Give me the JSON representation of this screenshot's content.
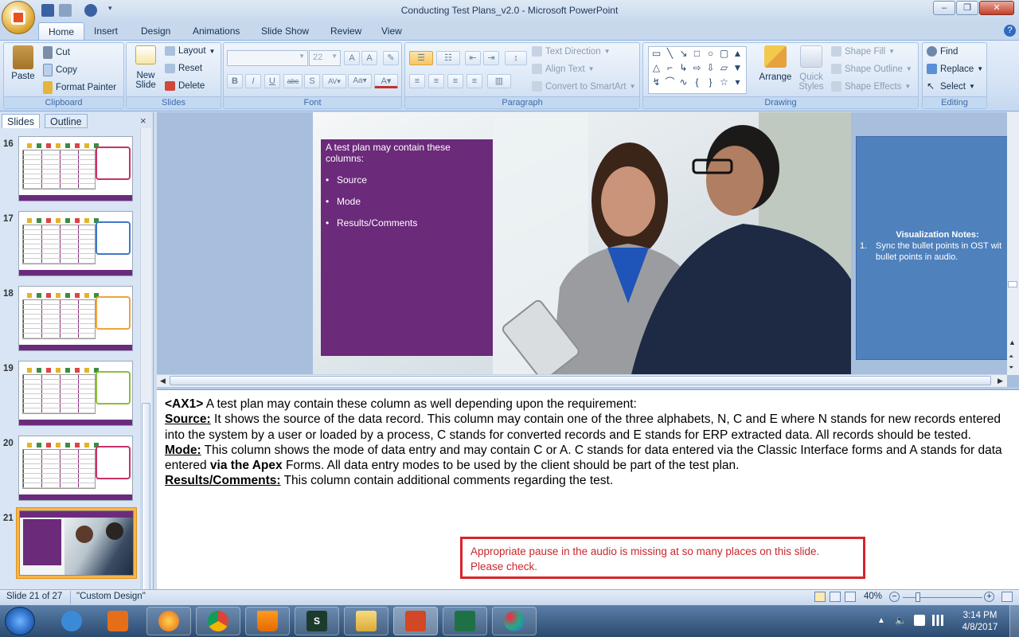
{
  "window": {
    "title": "Conducting Test Plans_v2.0 - Microsoft PowerPoint"
  },
  "ribbon_tabs": [
    "Home",
    "Insert",
    "Design",
    "Animations",
    "Slide Show",
    "Review",
    "View"
  ],
  "clipboard": {
    "paste": "Paste",
    "cut": "Cut",
    "copy": "Copy",
    "format_painter": "Format Painter",
    "label": "Clipboard"
  },
  "slides_group": {
    "new_slide_1": "New",
    "new_slide_2": "Slide",
    "layout": "Layout",
    "reset": "Reset",
    "delete": "Delete",
    "label": "Slides"
  },
  "font": {
    "size": "22",
    "label": "Font"
  },
  "paragraph": {
    "text_direction": "Text Direction",
    "align_text": "Align Text",
    "convert": "Convert to SmartArt",
    "label": "Paragraph"
  },
  "drawing": {
    "arrange": "Arrange",
    "quick_1": "Quick",
    "quick_2": "Styles",
    "shape_fill": "Shape Fill",
    "shape_outline": "Shape Outline",
    "shape_effects": "Shape Effects",
    "label": "Drawing"
  },
  "editing": {
    "find": "Find",
    "replace": "Replace",
    "select": "Select",
    "label": "Editing"
  },
  "left_pane": {
    "tab_slides": "Slides",
    "tab_outline": "Outline",
    "close": "×"
  },
  "thumbnails": [
    {
      "num": "16"
    },
    {
      "num": "17"
    },
    {
      "num": "18"
    },
    {
      "num": "19"
    },
    {
      "num": "20"
    },
    {
      "num": "21"
    }
  ],
  "slide": {
    "box_heading": "A test plan may contain these columns:",
    "bullets": [
      "Source",
      "Mode",
      "Results/Comments"
    ]
  },
  "vis_notes": {
    "title": "Visualization Notes:",
    "num": "1.",
    "text": "Sync the bullet points in OST wit bullet points in audio."
  },
  "notes": {
    "p1_tag": "<AX1>",
    "p1": " A test plan may contain these column as well depending upon the requirement:",
    "source_label": "Source:",
    "source_text": " It shows the source of the data record. This column may contain one of the three alphabets, N, C and E where N stands for new records entered into the system by a user or loaded by a process, C stands for converted records and E stands for ERP extracted data. All records should be tested.",
    "mode_label": "Mode:",
    "mode_text_1": " This column shows the mode of data entry and may contain C or A. C stands for data entered via the Classic Interface forms and A stands for data entered ",
    "mode_bold": "via the Apex",
    "mode_text_2": " Forms. All data entry modes to be used by the client should be part of the test plan.",
    "results_label": "Results/Comments:",
    "results_text": " This column contain additional comments regarding the test."
  },
  "review_comment": "Appropriate pause in the audio is missing at so many places on this slide. Please check.",
  "status": {
    "slide": "Slide 21 of 27",
    "theme": "\"Custom Design\"",
    "zoom": "40%"
  },
  "clock": {
    "time": "3:14 PM",
    "date": "4/8/2017"
  },
  "colors": {
    "accent_purple": "#6b2a7a",
    "notes_blue": "#4f81bd",
    "comment_red": "#d9242c"
  }
}
